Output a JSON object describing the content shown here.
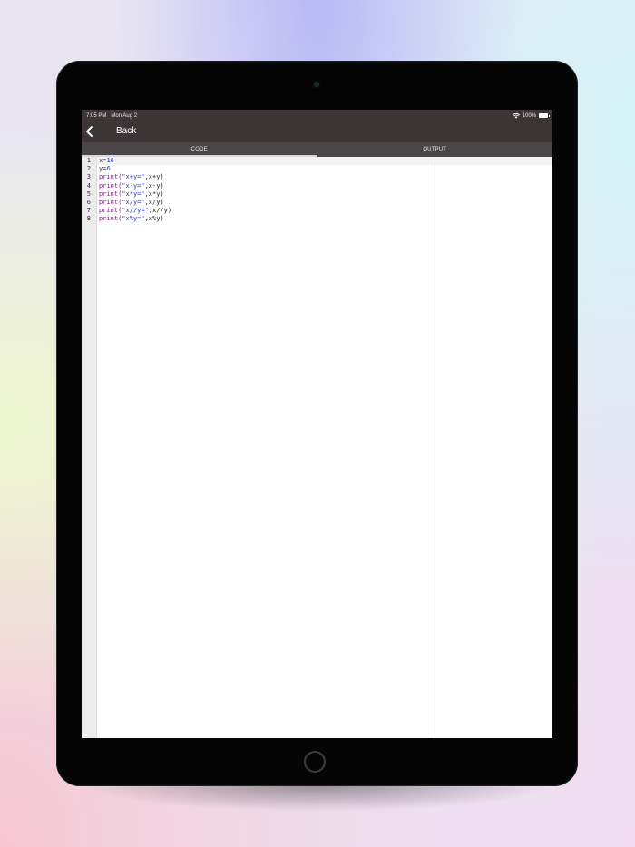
{
  "status": {
    "time": "7:05 PM",
    "date": "Mon Aug 2",
    "battery": "100%",
    "wifi_icon": "wifi-icon",
    "battery_icon": "battery-icon"
  },
  "nav": {
    "back_label": "Back",
    "back_icon": "chevron-left-icon"
  },
  "tabs": [
    {
      "label": "CODE",
      "active": true
    },
    {
      "label": "OUTPUT",
      "active": false
    }
  ],
  "editor": {
    "line_numbers": [
      "1",
      "2",
      "3",
      "4",
      "5",
      "6",
      "7",
      "8"
    ],
    "lines": [
      {
        "a": "x=",
        "b": "16",
        "c": "",
        "d": ""
      },
      {
        "a": "y=",
        "b": "6",
        "c": "",
        "d": ""
      },
      {
        "a": "print(",
        "b": "\"x+y=\"",
        "c": ",x+y)",
        "d": ""
      },
      {
        "a": "print(",
        "b": "\"x-y=\"",
        "c": ",x-y)",
        "d": ""
      },
      {
        "a": "print(",
        "b": "\"x*y=\"",
        "c": ",x*y)",
        "d": ""
      },
      {
        "a": "print(",
        "b": "\"x/y=\"",
        "c": ",x/y)",
        "d": ""
      },
      {
        "a": "print(",
        "b": "\"x//y=\"",
        "c": ",x//y)",
        "d": ""
      },
      {
        "a": "print(",
        "b": "\"x%y=\"",
        "c": ",x%y)",
        "d": ""
      }
    ]
  },
  "colors": {
    "header_bg": "#3b3536",
    "tab_bg": "#4a4546",
    "keyword": "#8a1a8a",
    "string": "#2b3ec2"
  }
}
